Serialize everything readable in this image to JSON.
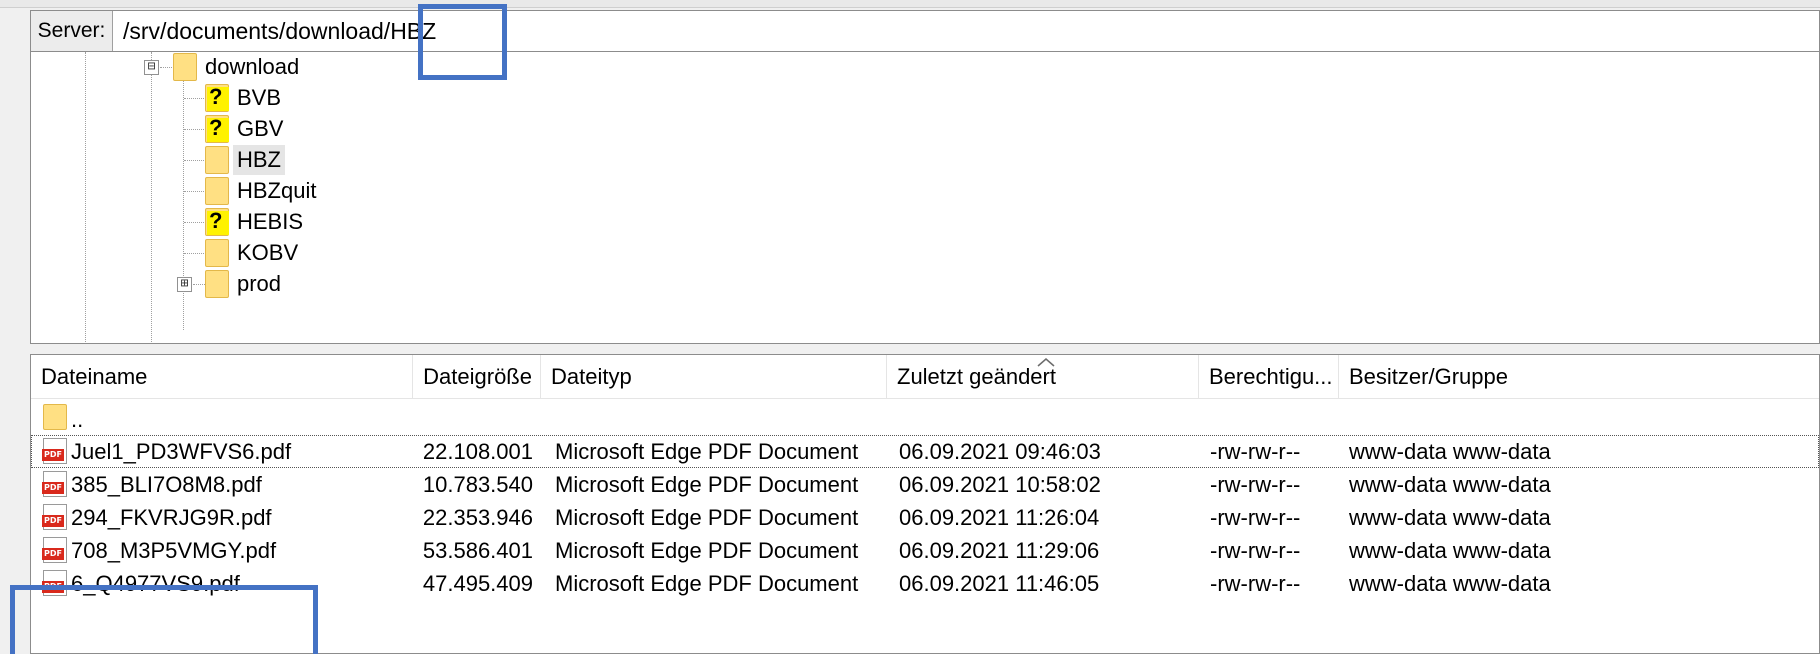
{
  "address": {
    "label": "Server:",
    "path": "/srv/documents/download/HBZ"
  },
  "tree": {
    "root": {
      "label": "download",
      "expander": "⊟"
    },
    "children": [
      {
        "label": "BVB",
        "icon": "question-folder-icon",
        "unknown": true
      },
      {
        "label": "GBV",
        "icon": "question-folder-icon",
        "unknown": true
      },
      {
        "label": "HBZ",
        "icon": "folder-icon",
        "unknown": false,
        "selected": true
      },
      {
        "label": "HBZquit",
        "icon": "folder-icon",
        "unknown": false
      },
      {
        "label": "HEBIS",
        "icon": "question-folder-icon",
        "unknown": true
      },
      {
        "label": "KOBV",
        "icon": "folder-icon",
        "unknown": false
      },
      {
        "label": "prod",
        "icon": "folder-icon",
        "unknown": false,
        "expander": "⊞"
      }
    ]
  },
  "list": {
    "columns": [
      "Dateiname",
      "Dateigröße",
      "Dateityp",
      "Zuletzt geändert",
      "Berechtigu...",
      "Besitzer/Gruppe"
    ],
    "parent_entry": "..",
    "rows": [
      {
        "name": "Juel1_PD3WFVS6.pdf",
        "size": "22.108.001",
        "type": "Microsoft Edge PDF Document",
        "modified": "06.09.2021 09:46:03",
        "perms": "-rw-rw-r--",
        "owner": "www-data www-data"
      },
      {
        "name": "385_BLI7O8M8.pdf",
        "size": "10.783.540",
        "type": "Microsoft Edge PDF Document",
        "modified": "06.09.2021 10:58:02",
        "perms": "-rw-rw-r--",
        "owner": "www-data www-data"
      },
      {
        "name": "294_FKVRJG9R.pdf",
        "size": "22.353.946",
        "type": "Microsoft Edge PDF Document",
        "modified": "06.09.2021 11:26:04",
        "perms": "-rw-rw-r--",
        "owner": "www-data www-data"
      },
      {
        "name": "708_M3P5VMGY.pdf",
        "size": "53.586.401",
        "type": "Microsoft Edge PDF Document",
        "modified": "06.09.2021 11:29:06",
        "perms": "-rw-rw-r--",
        "owner": "www-data www-data"
      },
      {
        "name": "6_Q4977VS9.pdf",
        "size": "47.495.409",
        "type": "Microsoft Edge PDF Document",
        "modified": "06.09.2021 11:46:05",
        "perms": "-rw-rw-r--",
        "owner": "www-data www-data"
      }
    ]
  },
  "colors": {
    "highlight": "#4472c4",
    "folder": "#ffe083",
    "pdf": "#d9291c"
  }
}
